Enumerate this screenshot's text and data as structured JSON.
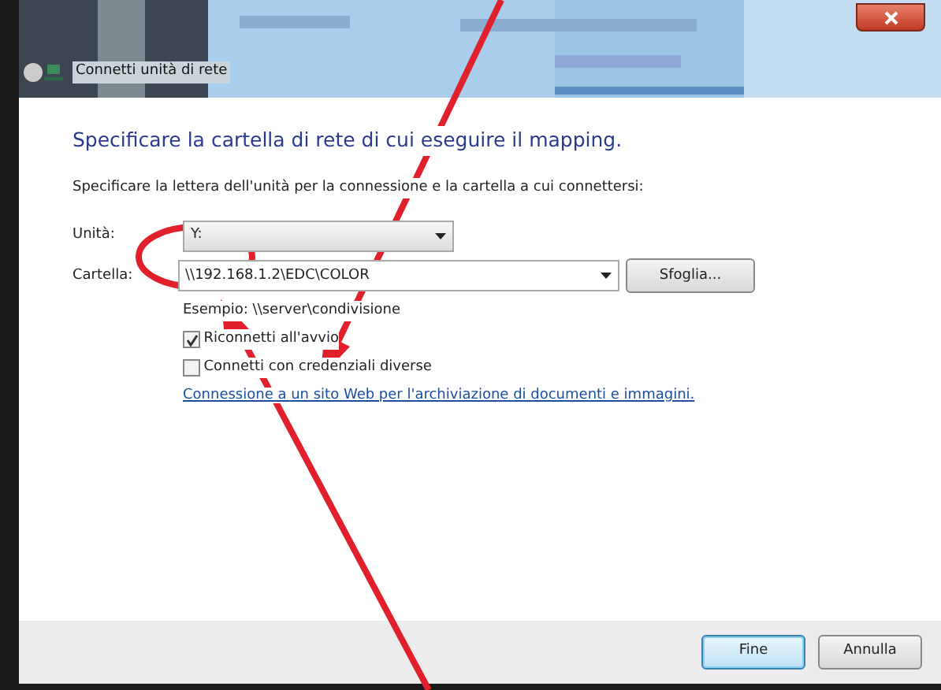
{
  "window": {
    "title": "Connetti unità di rete"
  },
  "heading": "Specificare la cartella di rete di cui eseguire il mapping.",
  "instruction": "Specificare la lettera dell'unità per la connessione e la cartella a cui connettersi:",
  "drive": {
    "label": "Unità:",
    "value": "Y:"
  },
  "folder": {
    "label": "Cartella:",
    "value": "\\\\192.168.1.2\\EDC\\COLOR"
  },
  "browse_button": "Sfoglia...",
  "example": "Esempio: \\\\server\\condivisione",
  "options": [
    {
      "label": "Riconnetti all'avvio",
      "checked": true
    },
    {
      "label": "Connetti con credenziali diverse",
      "checked": false
    }
  ],
  "link": "Connessione a un sito Web per l'archiviazione di documenti e immagini.",
  "buttons": [
    {
      "label": "Fine",
      "selected": true
    },
    {
      "label": "Annulla",
      "selected": false
    }
  ]
}
